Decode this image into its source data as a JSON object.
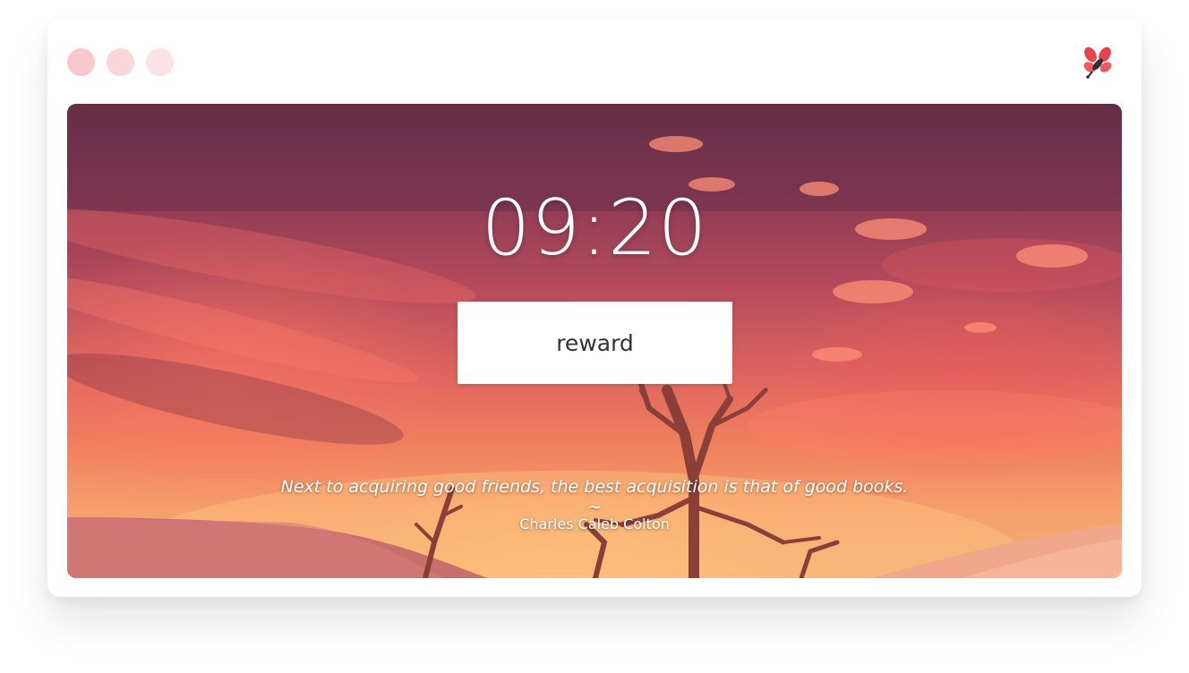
{
  "window": {
    "dot_colors": [
      "#f7c9cd",
      "#f9d6d9",
      "#fbe3e5"
    ],
    "logo_icon": "bee-logo-icon"
  },
  "colors": {
    "accent": "#e8424a",
    "button_bg": "#ffffff",
    "button_text": "#333333"
  },
  "clock": {
    "time": "09:20"
  },
  "reward_button": {
    "label": "reward"
  },
  "quote": {
    "text": "Next to acquiring good friends, the best acquisition is that of good books.",
    "separator": "~",
    "author": "Charles Caleb Colton"
  }
}
